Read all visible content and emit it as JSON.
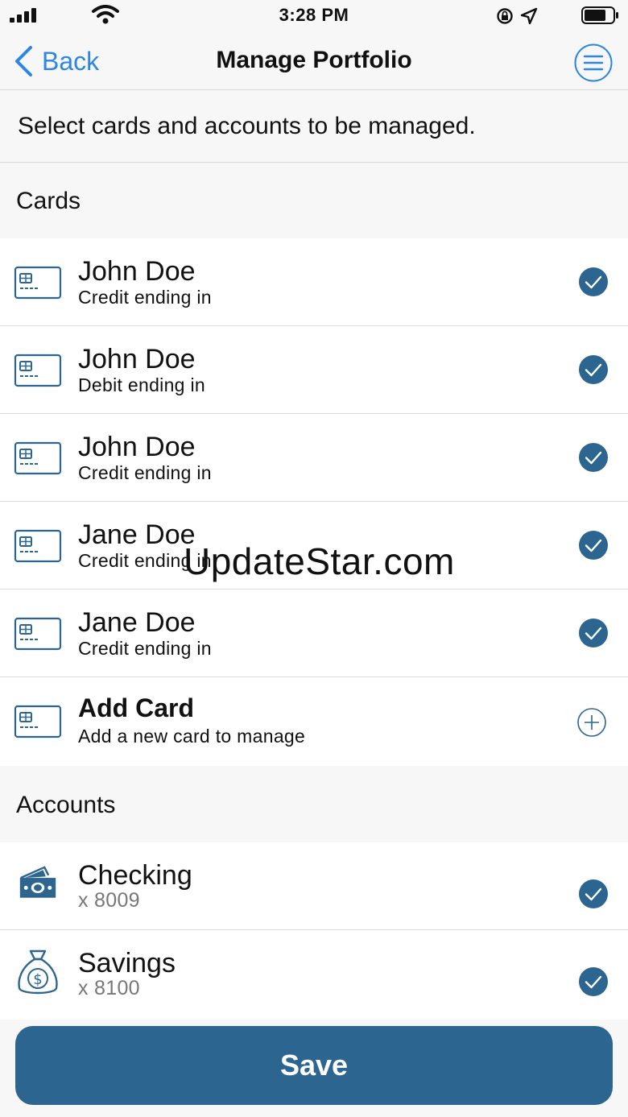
{
  "status_bar": {
    "time": "3:28 PM",
    "icons": [
      "signal-icon",
      "wifi-icon",
      "orientation-lock-icon",
      "location-icon",
      "battery-icon"
    ]
  },
  "nav": {
    "back_label": "Back",
    "title": "Manage Portfolio",
    "menu_icon": "menu-icon"
  },
  "instruction": "Select cards and accounts to be managed.",
  "cards_section": {
    "header": "Cards",
    "items": [
      {
        "name": "John Doe",
        "detail": "Credit ending in",
        "checked": true
      },
      {
        "name": "John Doe",
        "detail": "Debit ending in",
        "checked": true
      },
      {
        "name": "John Doe",
        "detail": "Credit ending in",
        "checked": true
      },
      {
        "name": "Jane Doe",
        "detail": "Credit ending in",
        "checked": true
      },
      {
        "name": "Jane Doe",
        "detail": "Credit ending in",
        "checked": true
      }
    ],
    "add": {
      "title": "Add Card",
      "detail": "Add a new card to manage"
    }
  },
  "accounts_section": {
    "header": "Accounts",
    "items": [
      {
        "name": "Checking",
        "detail": "x 8009",
        "icon": "cash-icon",
        "checked": true
      },
      {
        "name": "Savings",
        "detail": "x 8100",
        "icon": "money-bag-icon",
        "checked": true
      }
    ]
  },
  "watermark": "UpdateStar.com",
  "save_label": "Save",
  "colors": {
    "accent_blue": "#2d86e6",
    "primary": "#2c6690",
    "background": "#f7f7f7"
  }
}
